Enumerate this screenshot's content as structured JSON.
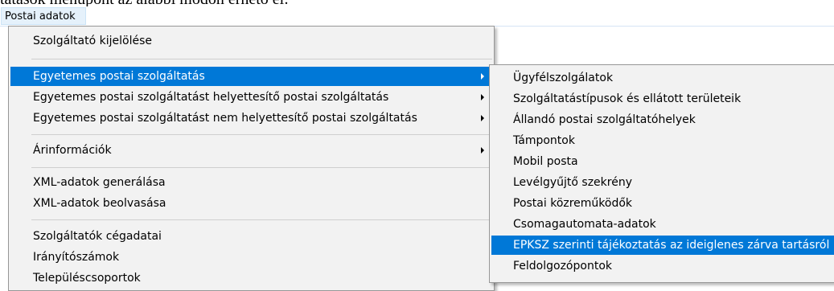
{
  "document": {
    "top_text": "tatások menüpont az alábbi módon érhető el:"
  },
  "menubar": {
    "title": "Postai adatok"
  },
  "main_menu": {
    "items": [
      "Szolgáltató kijelölése",
      "Egyetemes postai szolgáltatás",
      "Egyetemes postai szolgáltatást helyettesítő postai szolgáltatás",
      "Egyetemes postai szolgáltatást nem helyettesítő postai szolgáltatás",
      "Árinformációk",
      "XML-adatok generálása",
      "XML-adatok beolvasása",
      "Szolgáltatók cégadatai",
      "Irányítószámok",
      "Településcsoportok"
    ],
    "highlighted": "Egyetemes postai szolgáltatás"
  },
  "submenu": {
    "items": [
      "Ügyfélszolgálatok",
      "Szolgáltatástípusok és ellátott területeik",
      "Állandó postai szolgáltatóhelyek",
      "Támpontok",
      "Mobil posta",
      "Levélgyűjtő szekrény",
      "Postai közreműködők",
      "Csomagautomata-adatok",
      "EPKSZ szerinti tájékoztatás az ideiglenes zárva tartásról",
      "Feldolgozópontok"
    ],
    "highlighted": "EPKSZ szerinti tájékoztatás az ideiglenes zárva tartásról"
  },
  "colors": {
    "highlight": "#0078d7",
    "menu_background": "#f2f2f2"
  }
}
